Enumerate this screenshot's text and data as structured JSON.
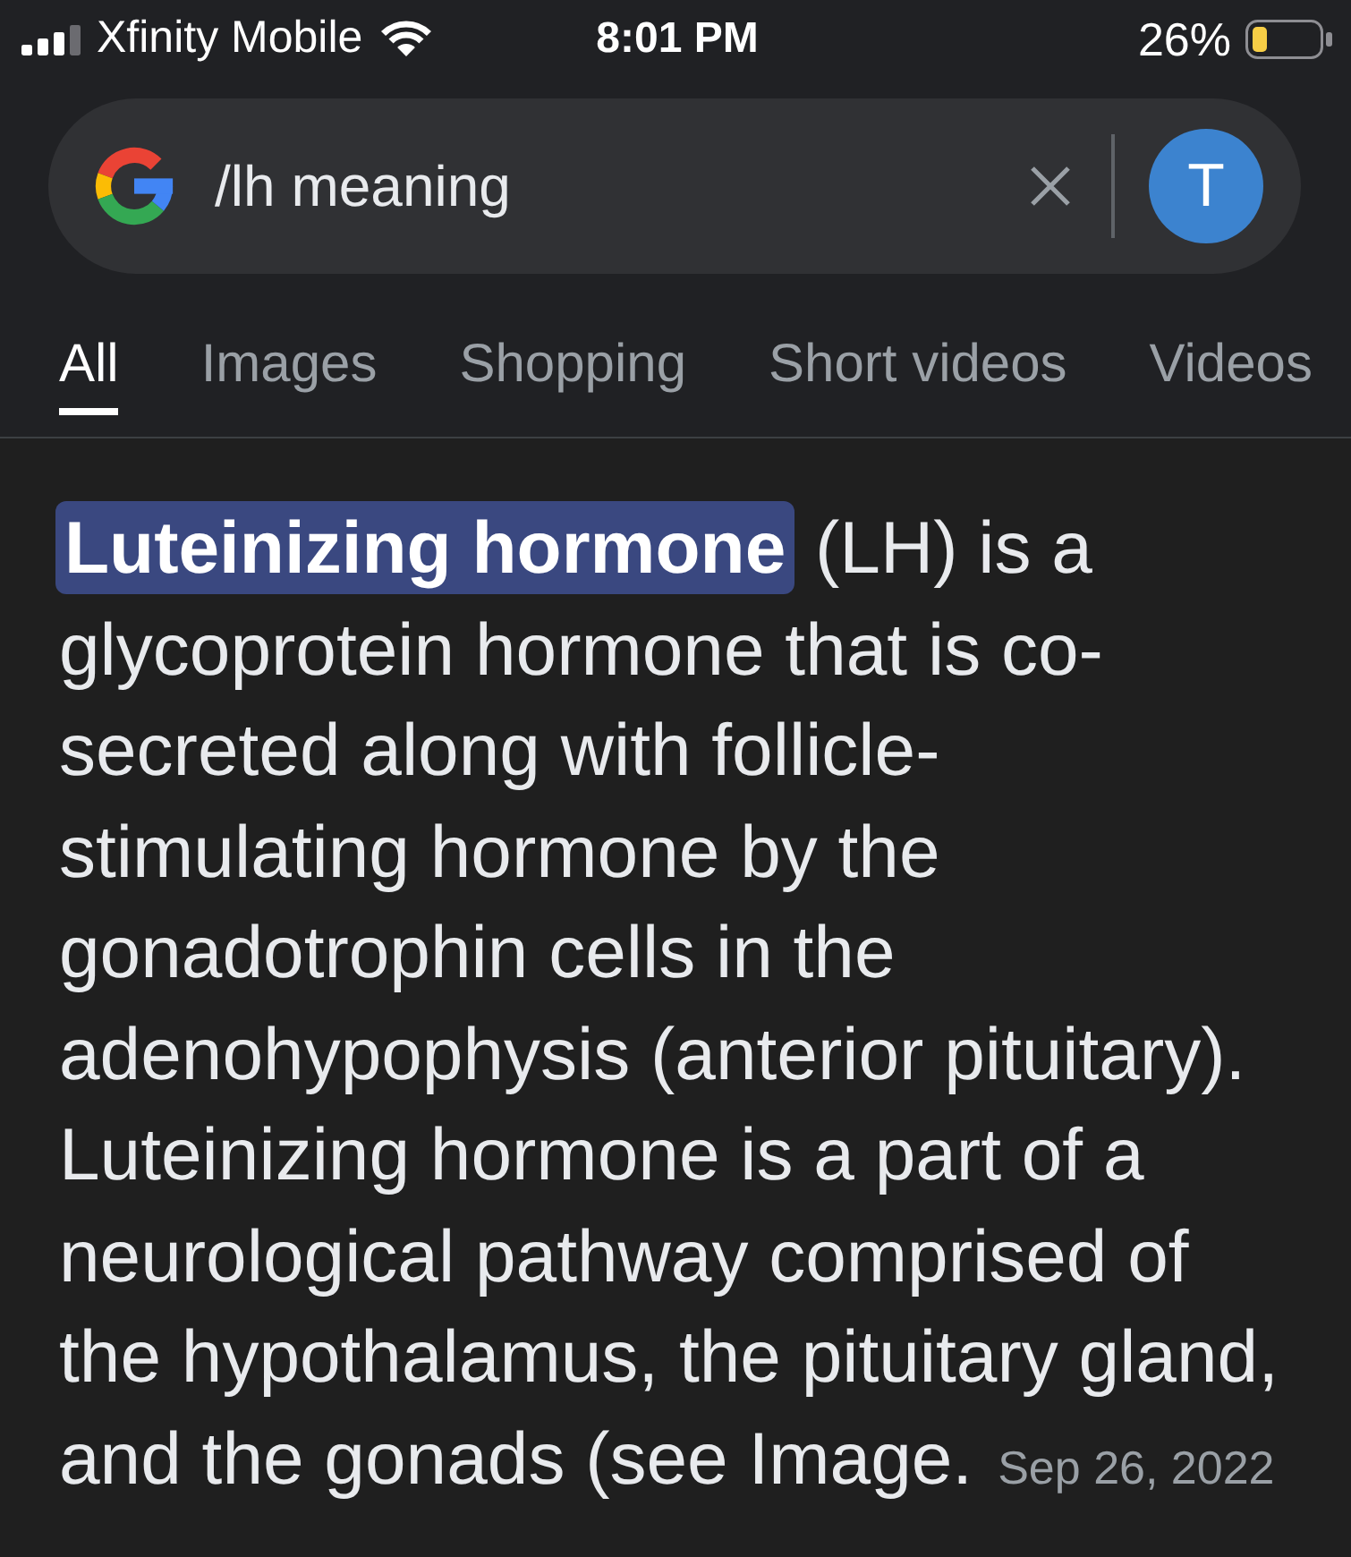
{
  "status_bar": {
    "carrier": "Xfinity Mobile",
    "time": "8:01 PM",
    "battery": "26%"
  },
  "search": {
    "value": "/lh meaning",
    "avatar_letter": "T"
  },
  "tabs": [
    {
      "label": "All",
      "selected": true
    },
    {
      "label": "Images",
      "selected": false
    },
    {
      "label": "Shopping",
      "selected": false
    },
    {
      "label": "Short videos",
      "selected": false
    },
    {
      "label": "Videos",
      "selected": false
    }
  ],
  "result": {
    "snippet": "**Luteinizing hormone** (LH) is a glycoprotein hormone that is co-secreted along with follicle-stimulating hormone by the gonadotrophin cells in the adenohypophysis (anterior pituitary). Luteinizing hormone is a part of a neurological pathway comprised of the hypothalamus, the pituitary gland, and the gonads (see Image.",
    "date": "Sep 26, 2022"
  }
}
